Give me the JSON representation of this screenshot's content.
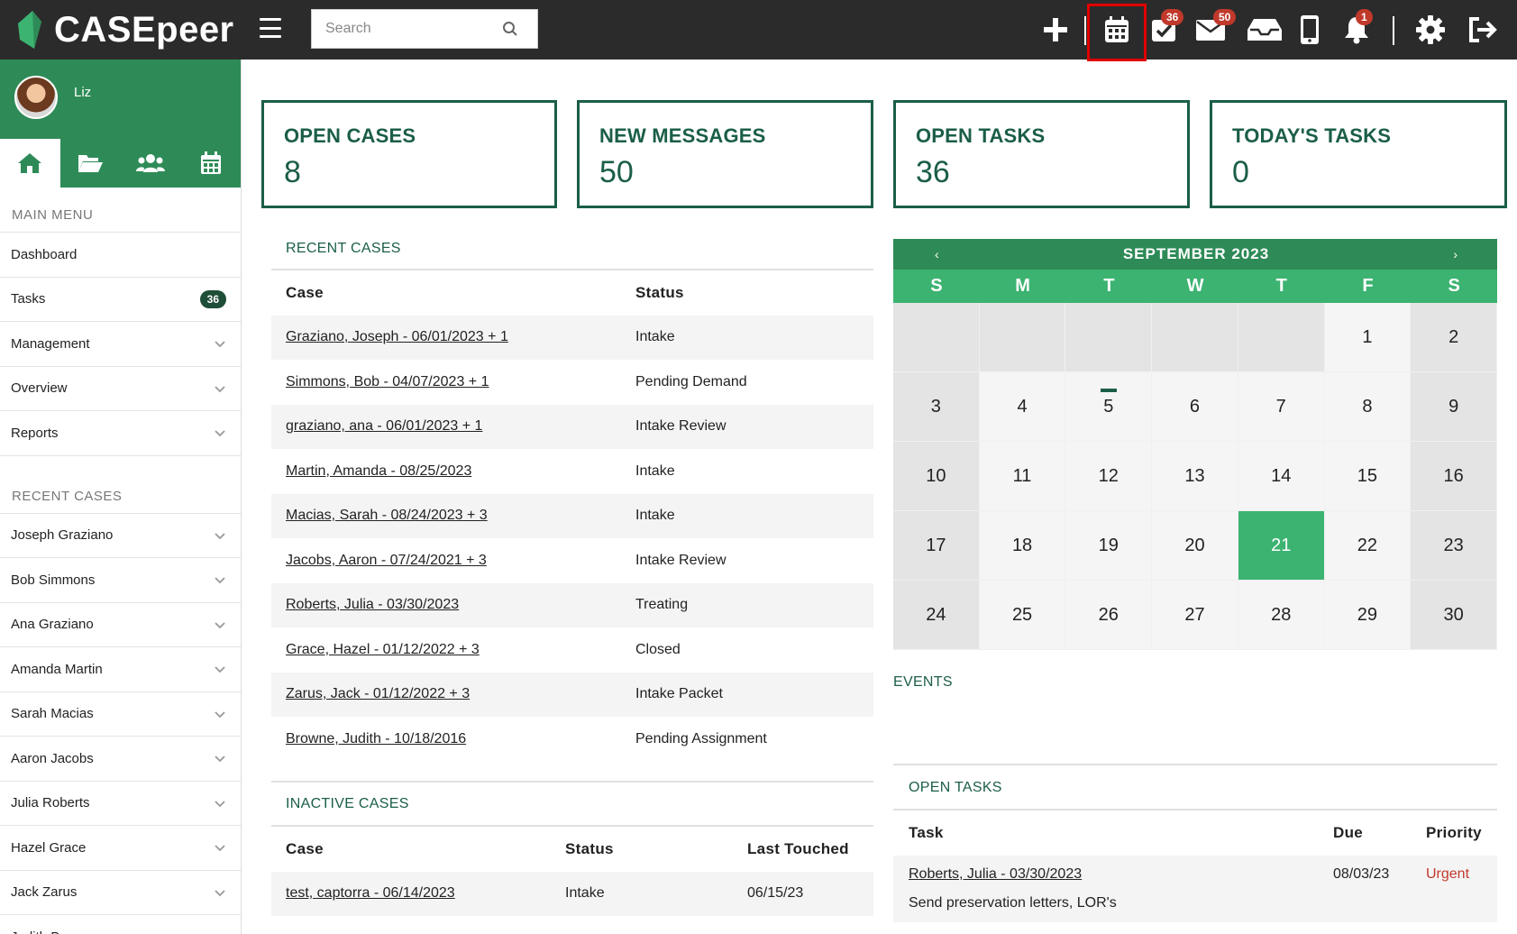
{
  "app": {
    "name": "CASEpeer"
  },
  "search": {
    "placeholder": "Search"
  },
  "topbar": {
    "tasks_badge": "36",
    "messages_badge": "50",
    "notifications_badge": "1"
  },
  "sidebar": {
    "user_name": "Liz",
    "main_menu_title": "MAIN MENU",
    "main_menu": [
      {
        "label": "Dashboard"
      },
      {
        "label": "Tasks",
        "badge": "36"
      },
      {
        "label": "Management"
      },
      {
        "label": "Overview"
      },
      {
        "label": "Reports"
      }
    ],
    "recent_cases_title": "RECENT CASES",
    "recent_cases": [
      {
        "label": "Joseph Graziano"
      },
      {
        "label": "Bob Simmons"
      },
      {
        "label": "Ana Graziano"
      },
      {
        "label": "Amanda Martin"
      },
      {
        "label": "Sarah Macias"
      },
      {
        "label": "Aaron Jacobs"
      },
      {
        "label": "Julia Roberts"
      },
      {
        "label": "Hazel Grace"
      },
      {
        "label": "Jack Zarus"
      },
      {
        "label": "Judith Browne"
      }
    ]
  },
  "stats": [
    {
      "title": "OPEN CASES",
      "value": "8"
    },
    {
      "title": "NEW MESSAGES",
      "value": "50"
    },
    {
      "title": "OPEN TASKS",
      "value": "36"
    },
    {
      "title": "TODAY'S TASKS",
      "value": "0"
    }
  ],
  "recent_cases": {
    "title": "RECENT CASES",
    "columns": [
      "Case",
      "Status"
    ],
    "rows": [
      {
        "case": "Graziano, Joseph - 06/01/2023 + 1",
        "status": "Intake"
      },
      {
        "case": "Simmons, Bob - 04/07/2023 + 1",
        "status": "Pending Demand"
      },
      {
        "case": "graziano, ana - 06/01/2023 + 1",
        "status": "Intake Review"
      },
      {
        "case": "Martin, Amanda - 08/25/2023",
        "status": "Intake"
      },
      {
        "case": "Macias, Sarah - 08/24/2023 + 3",
        "status": "Intake"
      },
      {
        "case": "Jacobs, Aaron - 07/24/2021 + 3",
        "status": "Intake Review"
      },
      {
        "case": "Roberts, Julia - 03/30/2023",
        "status": "Treating"
      },
      {
        "case": "Grace, Hazel - 01/12/2022 + 3",
        "status": "Closed"
      },
      {
        "case": "Zarus, Jack - 01/12/2022 + 3",
        "status": "Intake Packet"
      },
      {
        "case": "Browne, Judith - 10/18/2016",
        "status": "Pending Assignment"
      }
    ]
  },
  "inactive_cases": {
    "title": "INACTIVE CASES",
    "columns": [
      "Case",
      "Status",
      "Last Touched"
    ],
    "rows": [
      {
        "case": "test, captorra - 06/14/2023",
        "status": "Intake",
        "last_touched": "06/15/23"
      }
    ]
  },
  "calendar": {
    "month_label": "SEPTEMBER 2023",
    "prev": "‹",
    "next": "›",
    "weekdays": [
      "S",
      "M",
      "T",
      "W",
      "T",
      "F",
      "S"
    ],
    "leading_blanks": 5,
    "days_in_month": 30,
    "today": 21,
    "event_days": [
      5
    ]
  },
  "events": {
    "title": "EVENTS"
  },
  "open_tasks": {
    "title": "OPEN TASKS",
    "columns": [
      "Task",
      "Due",
      "Priority"
    ],
    "rows": [
      {
        "task": "Roberts, Julia - 03/30/2023",
        "due": "08/03/23",
        "priority": "Urgent",
        "description": "Send preservation letters, LOR's"
      }
    ]
  },
  "colors": {
    "brand_green": "#2e8b57",
    "light_green": "#3cb371",
    "dark_green": "#1b5e48",
    "urgent": "#c0392b",
    "topbar": "#2b2b2b"
  }
}
